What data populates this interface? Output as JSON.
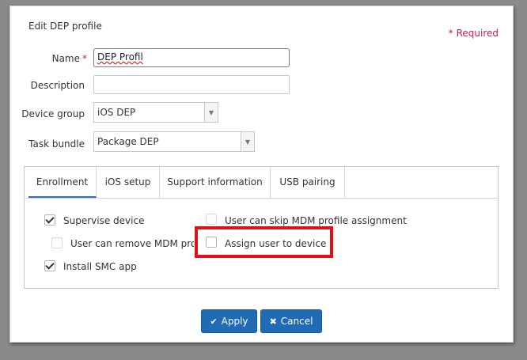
{
  "dialog": {
    "title": "Edit DEP profile",
    "required_note": "* Required"
  },
  "form": {
    "name_label": "Name",
    "required_star": "*",
    "name_value": "DEP Profil",
    "description_label": "Description",
    "description_value": "",
    "device_group_label": "Device group",
    "device_group_value": "iOS DEP",
    "task_bundle_label": "Task bundle",
    "task_bundle_value": "Package DEP"
  },
  "tabs": [
    {
      "label": "Enrollment",
      "active": true
    },
    {
      "label": "iOS setup",
      "active": false
    },
    {
      "label": "Support information",
      "active": false
    },
    {
      "label": "USB pairing",
      "active": false
    }
  ],
  "enrollment": {
    "supervise_device": {
      "label": "Supervise device",
      "checked": true
    },
    "user_remove_mdm": {
      "label": "User can remove MDM profile",
      "checked": false
    },
    "install_smc": {
      "label": "Install SMC app",
      "checked": true
    },
    "user_skip_mdm": {
      "label": "User can skip MDM profile assignment",
      "checked": false
    },
    "assign_user": {
      "label": "Assign user to device",
      "checked": false
    }
  },
  "buttons": {
    "apply": "Apply",
    "cancel": "Cancel"
  },
  "icons": {
    "apply": "check-icon",
    "cancel": "x-icon",
    "dropdown": "caret-down-icon"
  },
  "colors": {
    "primary": "#1f6bb4",
    "required": "#c8195c",
    "highlight": "#e30e16"
  }
}
